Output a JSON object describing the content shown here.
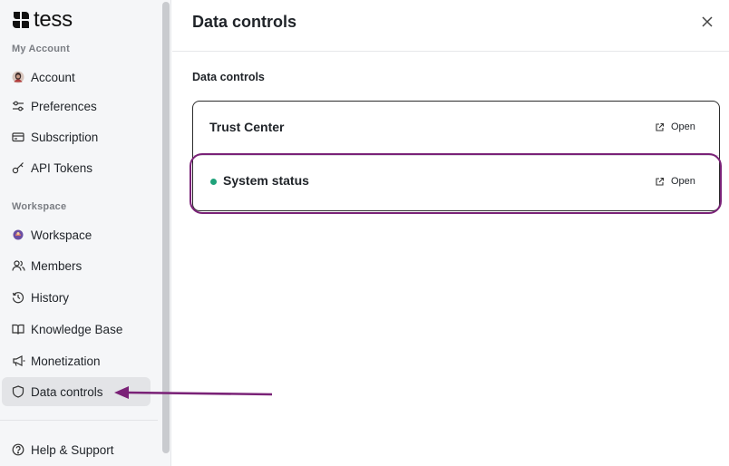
{
  "app": {
    "name": "tess"
  },
  "sidebar": {
    "my_account_label": "My Account",
    "workspace_label": "Workspace",
    "items": [
      {
        "label": "Account",
        "icon": "avatar-icon"
      },
      {
        "label": "Preferences",
        "icon": "sliders-icon"
      },
      {
        "label": "Subscription",
        "icon": "credit-card-icon"
      },
      {
        "label": "API Tokens",
        "icon": "key-icon"
      },
      {
        "label": "Workspace",
        "icon": "workspace-avatar-icon"
      },
      {
        "label": "Members",
        "icon": "users-icon"
      },
      {
        "label": "History",
        "icon": "history-icon"
      },
      {
        "label": "Knowledge Base",
        "icon": "book-icon"
      },
      {
        "label": "Monetization",
        "icon": "megaphone-icon"
      },
      {
        "label": "Data controls",
        "icon": "shield-icon",
        "active": true
      },
      {
        "label": "Help & Support",
        "icon": "help-icon"
      }
    ]
  },
  "main": {
    "title": "Data controls",
    "section_heading": "Data controls",
    "rows": [
      {
        "title": "Trust Center",
        "action": "Open"
      },
      {
        "title": "System status",
        "action": "Open",
        "status_color": "#1fa27a"
      }
    ]
  },
  "colors": {
    "annotation": "#7a2277",
    "sidebar_bg": "#f5f6f8",
    "active_item_bg": "#e3e4e7",
    "status_ok": "#1fa27a"
  }
}
